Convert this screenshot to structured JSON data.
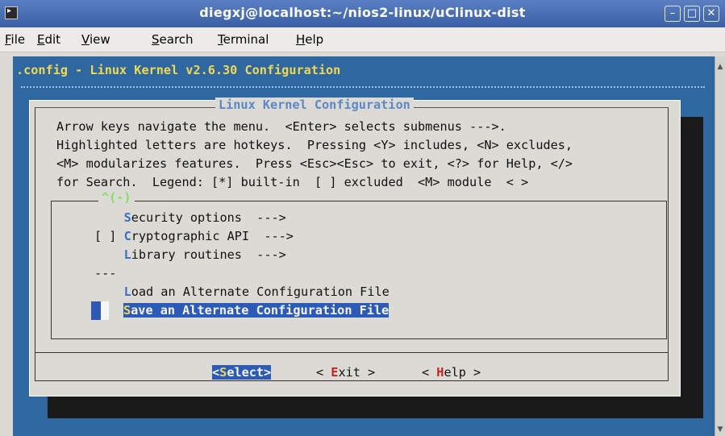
{
  "window": {
    "title": "diegxj@localhost:~/nios2-linux/uClinux-dist"
  },
  "menubar": [
    "File",
    "Edit",
    "View",
    "Search",
    "Terminal",
    "Help"
  ],
  "terminal": {
    "header": ".config - Linux Kernel v2.6.30 Configuration",
    "dialog_title": "Linux Kernel Configuration",
    "instructions": [
      "Arrow keys navigate the menu.  <Enter> selects submenus --->.",
      "Highlighted letters are hotkeys.  Pressing <Y> includes, <N> excludes,",
      "<M> modularizes features.  Press <Esc><Esc> to exit, <?> for Help, </>",
      "for Search.  Legend: [*] built-in  [ ] excluded  <M> module  < >"
    ],
    "scroll_indicator": "^(-)",
    "menu": [
      {
        "prefix": "    ",
        "hotkey": "S",
        "rest": "ecurity options  --->"
      },
      {
        "prefix": "[ ] ",
        "hotkey": "C",
        "rest": "ryptographic API  --->"
      },
      {
        "prefix": "    ",
        "hotkey": "L",
        "rest": "ibrary routines  --->"
      },
      {
        "prefix": "",
        "hotkey": "",
        "rest": "---"
      },
      {
        "prefix": "    ",
        "hotkey": "L",
        "rest": "oad an Alternate Configuration File"
      },
      {
        "prefix": "    ",
        "hotkey": "S",
        "rest": "ave an Alternate Configuration File"
      }
    ],
    "buttons": {
      "select": {
        "pre": "<",
        "hot": "S",
        "post": "elect>"
      },
      "exit": {
        "pre": "< ",
        "hot": "E",
        "post": "xit >"
      },
      "help": {
        "pre": "< ",
        "hot": "H",
        "post": "elp >"
      }
    }
  },
  "colors": {
    "terminal_bg": "#2f68a0",
    "dialog_bg": "#dcdad5",
    "header_text": "#f0d850",
    "hotkey": "#3b6fc7",
    "selection": "#2c5ab8"
  }
}
